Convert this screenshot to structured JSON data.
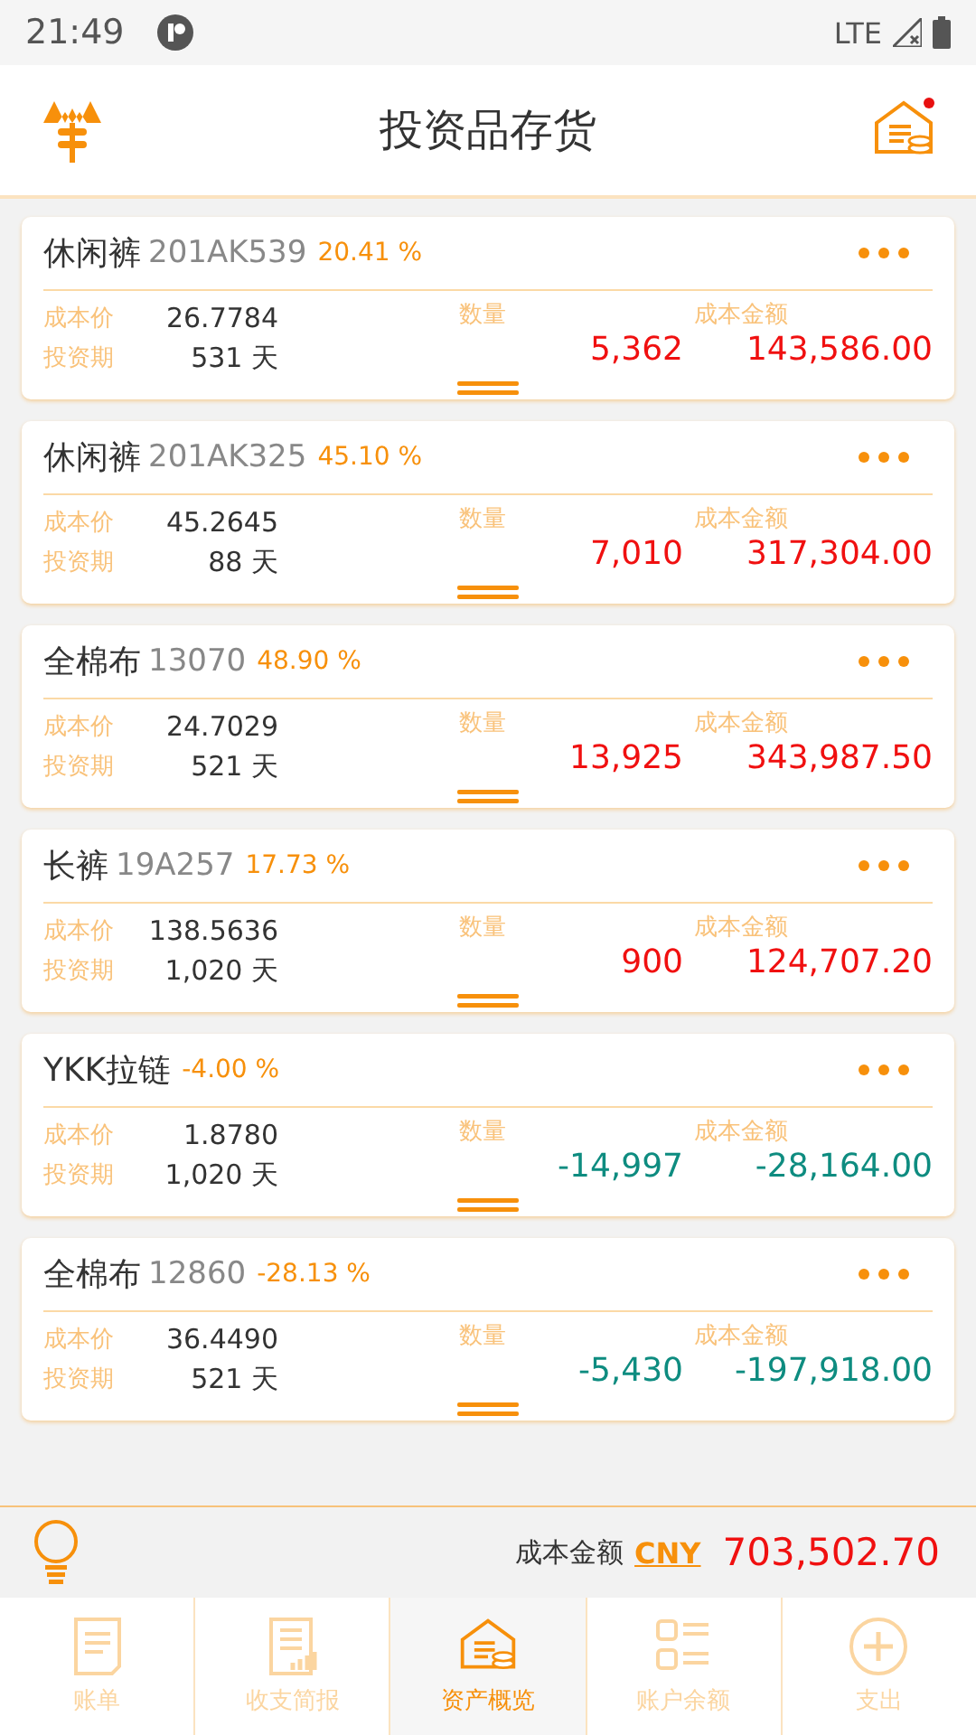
{
  "status_bar": {
    "time": "21:49",
    "network": "LTE"
  },
  "header": {
    "title": "投资品存货",
    "notification": true
  },
  "items": [
    {
      "name": "休闲裤",
      "code": "201AK539",
      "percent": "20.41 %",
      "price_label": "成本价",
      "price": "26.7784",
      "period_label": "投资期",
      "period": "531 天",
      "qty_label": "数量",
      "qty": "5,362",
      "amount_label": "成本金额",
      "amount": "143,586.00",
      "kind": "gain"
    },
    {
      "name": "休闲裤",
      "code": "201AK325",
      "percent": "45.10 %",
      "price_label": "成本价",
      "price": "45.2645",
      "period_label": "投资期",
      "period": "88 天",
      "qty_label": "数量",
      "qty": "7,010",
      "amount_label": "成本金额",
      "amount": "317,304.00",
      "kind": "gain"
    },
    {
      "name": "全棉布",
      "code": "13070",
      "percent": "48.90 %",
      "price_label": "成本价",
      "price": "24.7029",
      "period_label": "投资期",
      "period": "521 天",
      "qty_label": "数量",
      "qty": "13,925",
      "amount_label": "成本金额",
      "amount": "343,987.50",
      "kind": "gain"
    },
    {
      "name": "长裤",
      "code": "19A257",
      "percent": "17.73 %",
      "price_label": "成本价",
      "price": "138.5636",
      "period_label": "投资期",
      "period": "1,020 天",
      "qty_label": "数量",
      "qty": "900",
      "amount_label": "成本金额",
      "amount": "124,707.20",
      "kind": "gain"
    },
    {
      "name": "YKK拉链",
      "percent": "-4.00 %",
      "price_label": "成本价",
      "price": "1.8780",
      "period_label": "投资期",
      "period": "1,020 天",
      "qty_label": "数量",
      "qty": "-14,997",
      "amount_label": "成本金额",
      "amount": "-28,164.00",
      "kind": "loss"
    },
    {
      "name": "全棉布",
      "code": "12860",
      "percent": "-28.13 %",
      "price_label": "成本价",
      "price": "36.4490",
      "period_label": "投资期",
      "period": "521 天",
      "qty_label": "数量",
      "qty": "-5,430",
      "amount_label": "成本金额",
      "amount": "-197,918.00",
      "kind": "loss"
    }
  ],
  "summary": {
    "label": "成本金额",
    "currency": "CNY",
    "total": "703,502.70"
  },
  "tabs": [
    {
      "label": "账单",
      "selected": false
    },
    {
      "label": "收支简报",
      "selected": false
    },
    {
      "label": "资产概览",
      "selected": true
    },
    {
      "label": "账户余额",
      "selected": false
    },
    {
      "label": "支出",
      "selected": false
    }
  ]
}
